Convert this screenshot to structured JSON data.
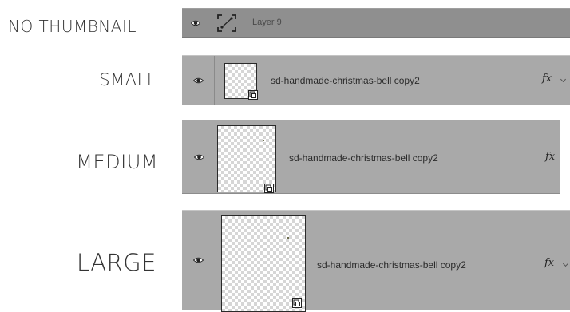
{
  "rows": [
    {
      "size_label": "NO THUMBNAIL",
      "layer_name": "Layer 9",
      "icons": {
        "eye": "eye-icon",
        "layer_type": "layer-icon"
      }
    },
    {
      "size_label": "SMALL",
      "layer_name": "sd-handmade-christmas-bell copy2",
      "fx_label": "fx",
      "icons": {
        "eye": "eye-icon",
        "badge": "smart-object-icon",
        "fx_arrow": "chevron-down-icon"
      }
    },
    {
      "size_label": "MEDIUM",
      "layer_name": "sd-handmade-christmas-bell copy2",
      "fx_label": "fx",
      "icons": {
        "eye": "eye-icon",
        "badge": "smart-object-icon"
      }
    },
    {
      "size_label": "LARGE",
      "layer_name": "sd-handmade-christmas-bell copy2",
      "fx_label": "fx",
      "icons": {
        "eye": "eye-icon",
        "badge": "smart-object-icon",
        "fx_arrow": "chevron-down-icon"
      }
    }
  ],
  "colors": {
    "row_bg": "#a9a9a9",
    "row_bg_dark": "#8f8f8f",
    "label_text": "#333333"
  }
}
